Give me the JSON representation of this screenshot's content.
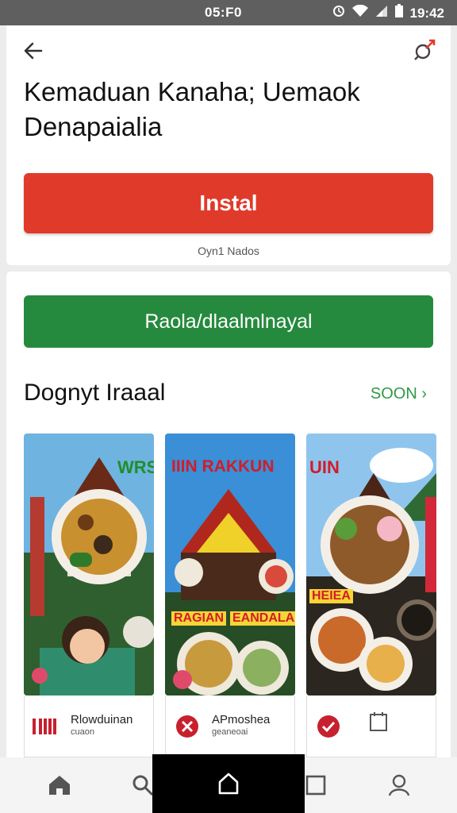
{
  "status_bar": {
    "left_text": "05:F0",
    "time": "19:42",
    "icons": [
      "alarm-icon",
      "wifi-icon",
      "signal-icon",
      "battery-icon"
    ]
  },
  "header": {
    "title": "Kemaduan Kanaha; Uemaok Denapaialia",
    "install_label": "Instal",
    "sub_note": "Oyn1 Nados"
  },
  "main": {
    "action_label": "Raola/dlaalmlnayal",
    "section_title": "Dognyt Iraaal",
    "see_more": "SOON ›",
    "screenshots": [
      {
        "label": "WRS"
      },
      {
        "label": "IIIN RAKKUN",
        "label2": "RAGIAN",
        "label3": "EANDALAA"
      },
      {
        "label": "UIN",
        "label2": "HEIEA"
      }
    ],
    "apps": [
      {
        "name": "Rlowduinan",
        "sub": "cuaon"
      },
      {
        "name": "APmoshea",
        "sub": "geaneoai"
      },
      {
        "name": "",
        "sub": ""
      }
    ]
  },
  "bottom_nav": {
    "items": [
      "home-icon",
      "search-icon",
      "apps-icon",
      "square-icon",
      "profile-icon"
    ]
  },
  "colors": {
    "accent_red": "#e03a2b",
    "accent_green": "#268a3e",
    "link_green": "#2e9a46"
  }
}
